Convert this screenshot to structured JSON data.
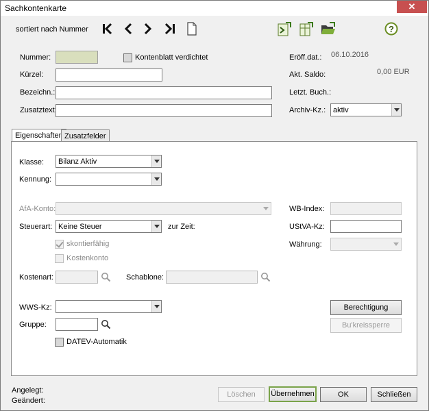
{
  "window": {
    "title": "Sachkontenkarte",
    "close_glyph": "✕"
  },
  "toolbar": {
    "sort_label": "sortiert nach Nummer",
    "icons": [
      "first-record-icon",
      "previous-record-icon",
      "next-record-icon",
      "last-record-icon",
      "new-document-icon",
      "export-calc-icon",
      "export-table-icon",
      "open-folder-icon",
      "help-icon"
    ]
  },
  "header": {
    "nummer_label": "Nummer:",
    "nummer_value": "",
    "kontenblatt_label": "Kontenblatt verdichtet",
    "kuerzel_label": "Kürzel:",
    "bezeichn_label": "Bezeichn.:",
    "zusatztext_label": "Zusatztext:",
    "eroeffdat_label": "Eröff.dat.:",
    "eroeffdat_value": "06.10.2016",
    "saldo_label": "Akt.  Saldo:",
    "saldo_value": "0,00 EUR",
    "letzt_buch_label": "Letzt. Buch.:",
    "archiv_label": "Archiv-Kz.:",
    "archiv_value": "aktiv"
  },
  "tabs": [
    {
      "label": "Eigenschaften"
    },
    {
      "label": "Zusatzfelder"
    }
  ],
  "eigenschaften": {
    "klasse_label": "Klasse:",
    "klasse_value": "Bilanz Aktiv",
    "kennung_label": "Kennung:",
    "afa_label": "AfA-Konto:",
    "wb_index_label": "WB-Index:",
    "steuerart_label": "Steuerart:",
    "steuerart_value": "Keine Steuer",
    "zur_zeit_label": "zur Zeit:",
    "ustva_label": "UStVA-Kz:",
    "skonto_label": "skontierfähig",
    "waehrung_label": "Währung:",
    "kostenkonto_label": "Kostenkonto",
    "kostenart_label": "Kostenart:",
    "schablone_label": "Schablone:",
    "wws_label": "WWS-Kz:",
    "berechtigung_label": "Berechtigung",
    "gruppe_label": "Gruppe:",
    "bukreis_label": "Bu'kreissperre",
    "datev_label": "DATEV-Automatik"
  },
  "footer": {
    "angelegt_label": "Angelegt:",
    "geaendert_label": "Geändert:",
    "loeschen_label": "Löschen",
    "uebernehmen_label": "Übernehmen",
    "ok_label": "OK",
    "schliessen_label": "Schließen"
  }
}
